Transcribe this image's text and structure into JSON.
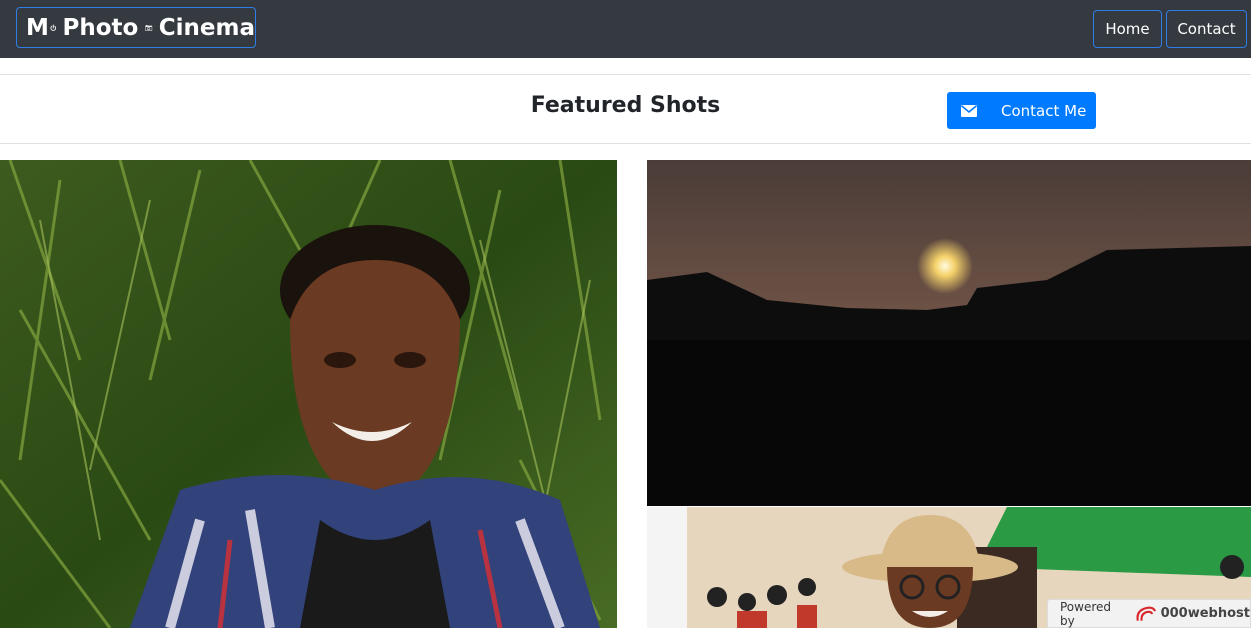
{
  "navbar": {
    "brand_prefix": "M",
    "brand_word1": "Photo",
    "brand_word2": "Cinema",
    "brand_icons": [
      "power-icon",
      "camera-icon"
    ],
    "links": [
      "Home",
      "Contact"
    ],
    "accent": "#2f7ee5",
    "background": "#343a40"
  },
  "featured": {
    "title": "Featured Shots",
    "contact_label": "Contact Me",
    "contact_icon": "envelope-icon",
    "button_color": "#007bff"
  },
  "photos": [
    {
      "subject": "man-smiling-in-grass"
    },
    {
      "subject": "sunset-over-buildings"
    },
    {
      "subject": "woman-with-hat-at-market"
    }
  ],
  "footer_badge": {
    "prefix": "Powered by",
    "brand": "000webhost"
  }
}
